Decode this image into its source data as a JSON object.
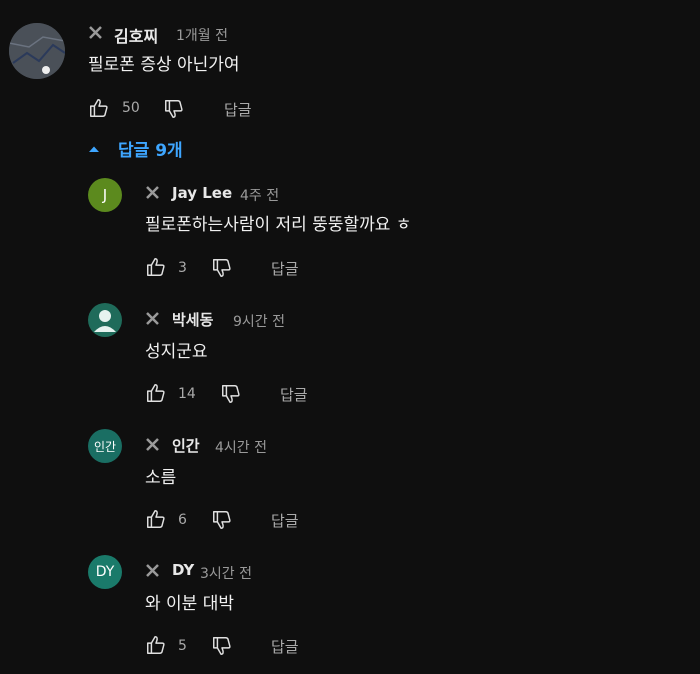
{
  "main": {
    "author": "김호찌",
    "time": "1개월 전",
    "text": "필로폰 증상 아닌가여",
    "likes": "50",
    "reply_label": "답글"
  },
  "replies_toggle": "답글 9개",
  "replies": [
    {
      "avatar": "J",
      "author": "Jay Lee",
      "time": "4주 전",
      "text": "필로폰하는사람이 저리 뚱뚱할까요 ㅎ",
      "likes": "3",
      "reply_label": "답글",
      "avatar_color": "#5c8a1e"
    },
    {
      "avatar": "",
      "author": "박세동",
      "time": "9시간 전",
      "text": "성지군요",
      "likes": "14",
      "reply_label": "답글",
      "avatar_color": "#1f6b5a"
    },
    {
      "avatar": "인간",
      "author": "인간",
      "time": "4시간 전",
      "text": "소름",
      "likes": "6",
      "reply_label": "답글",
      "avatar_color": "#1a6e63"
    },
    {
      "avatar": "DY",
      "author": "DY",
      "time": "3시간 전",
      "text": "와 이분 대박",
      "likes": "5",
      "reply_label": "답글",
      "avatar_color": "#1a7a6a"
    }
  ],
  "colors": {
    "background": "#0f0f0f",
    "link": "#3ea6ff",
    "muted": "#aaaaaa"
  }
}
